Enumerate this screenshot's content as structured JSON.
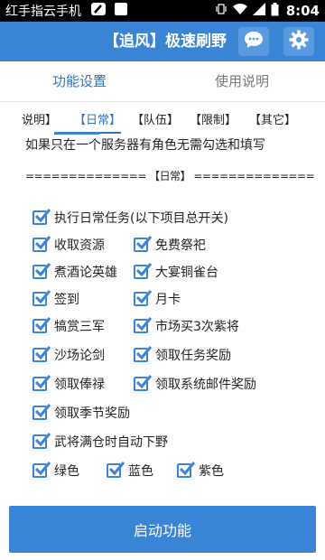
{
  "status_bar": {
    "carrier": "红手指云手机",
    "time": "8:04"
  },
  "app_bar": {
    "title": "【追风】极速刷野",
    "chat_icon": "chat-bubble-icon",
    "settings_icon": "gear-icon"
  },
  "tabs": [
    {
      "label": "功能设置",
      "active": true
    },
    {
      "label": "使用说明",
      "active": false
    }
  ],
  "sub_tabs": [
    {
      "label": "说明】"
    },
    {
      "label": "【日常】",
      "active": true
    },
    {
      "label": "【队伍】"
    },
    {
      "label": "【限制】"
    },
    {
      "label": "【其它】"
    }
  ],
  "note": "如果只在一个服务器有角色无需勾选和填写",
  "section_divider": "============== 【日常】 ==============",
  "checkboxes": [
    {
      "label": "执行日常任务(以下项目总开关)",
      "checked": true
    },
    {
      "label": "收取资源",
      "checked": true
    },
    {
      "label": "免费祭祀",
      "checked": true
    },
    {
      "label": "煮酒论英雄",
      "checked": true
    },
    {
      "label": "大宴铜雀台",
      "checked": true
    },
    {
      "label": "签到",
      "checked": true
    },
    {
      "label": "月卡",
      "checked": true
    },
    {
      "label": "犒赏三军",
      "checked": true
    },
    {
      "label": "市场买3次紫将",
      "checked": true
    },
    {
      "label": "沙场论剑",
      "checked": true
    },
    {
      "label": "领取任务奖励",
      "checked": true
    },
    {
      "label": "领取俸禄",
      "checked": true
    },
    {
      "label": "领取系统邮件奖励",
      "checked": true
    },
    {
      "label": "领取季节奖励",
      "checked": true
    },
    {
      "label": "武将满仓时自动下野",
      "checked": true
    },
    {
      "label": "绿色",
      "checked": true
    },
    {
      "label": "蓝色",
      "checked": true
    },
    {
      "label": "紫色",
      "checked": true
    }
  ],
  "start_button": {
    "label": "启动功能"
  },
  "colors": {
    "accent": "#3a84d6",
    "status_bar": "#000000",
    "background": "#ffffff"
  }
}
